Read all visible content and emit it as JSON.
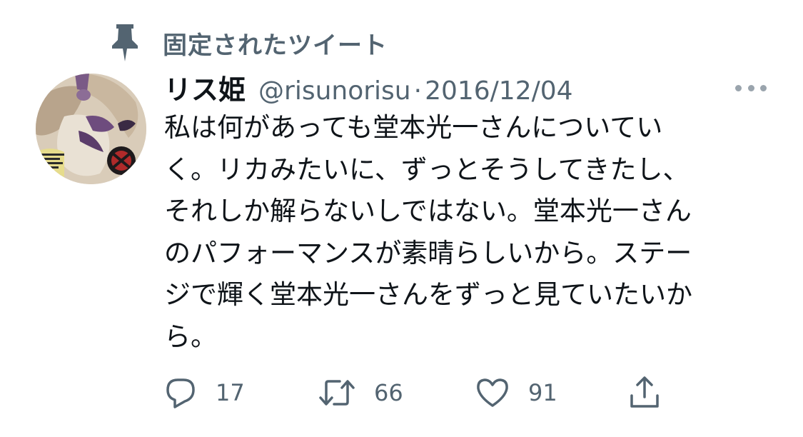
{
  "pinned": {
    "label": "固定されたツイート",
    "icon": "pin-icon"
  },
  "tweet": {
    "display_name": "リス姫",
    "handle": "@risunorisu",
    "separator": "·",
    "date": "2016/12/04",
    "text_lines": [
      "私は何があっても堂本光一さんについてい",
      "く。リカみたいに、ずっとそうしてきたし、",
      "それしか解らないしではない。堂本光一さん",
      "のパフォーマンスが素晴らしいから。ステー",
      "ジで輝く堂本光一さんをずっと見ていたいか",
      "ら。"
    ]
  },
  "actions": {
    "reply": {
      "icon": "reply-icon",
      "count": "17"
    },
    "retweet": {
      "icon": "retweet-icon",
      "count": "66"
    },
    "like": {
      "icon": "heart-icon",
      "count": "91"
    },
    "share": {
      "icon": "share-icon"
    }
  },
  "colors": {
    "secondary_text": "#536471",
    "primary_text": "#0f1419"
  }
}
